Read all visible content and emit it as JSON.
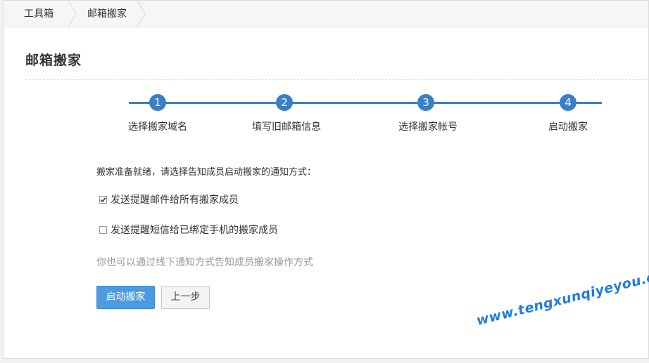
{
  "breadcrumb": {
    "items": [
      {
        "label": "工具箱"
      },
      {
        "label": "邮箱搬家"
      }
    ]
  },
  "page": {
    "title": "邮箱搬家"
  },
  "steps": [
    {
      "number": "1",
      "label": "选择搬家域名"
    },
    {
      "number": "2",
      "label": "填写旧邮箱信息"
    },
    {
      "number": "3",
      "label": "选择搬家帐号"
    },
    {
      "number": "4",
      "label": "启动搬家"
    }
  ],
  "form": {
    "prompt": "搬家准备就绪，请选择告知成员启动搬家的通知方式：",
    "options": [
      {
        "label": "发送提醒邮件给所有搬家成员",
        "checked": true
      },
      {
        "label": "发送提醒短信给已绑定手机的搬家成员",
        "checked": false
      }
    ],
    "hint": "你也可以通过线下通知方式告知成员搬家操作方式"
  },
  "buttons": {
    "start": "启动搬家",
    "back": "上一步"
  },
  "watermark": "www.tengxunqiyeyou.com",
  "colors": {
    "accent": "#3a7fc4",
    "primary_button": "#4c9be0",
    "watermark": "#1f7de0"
  }
}
